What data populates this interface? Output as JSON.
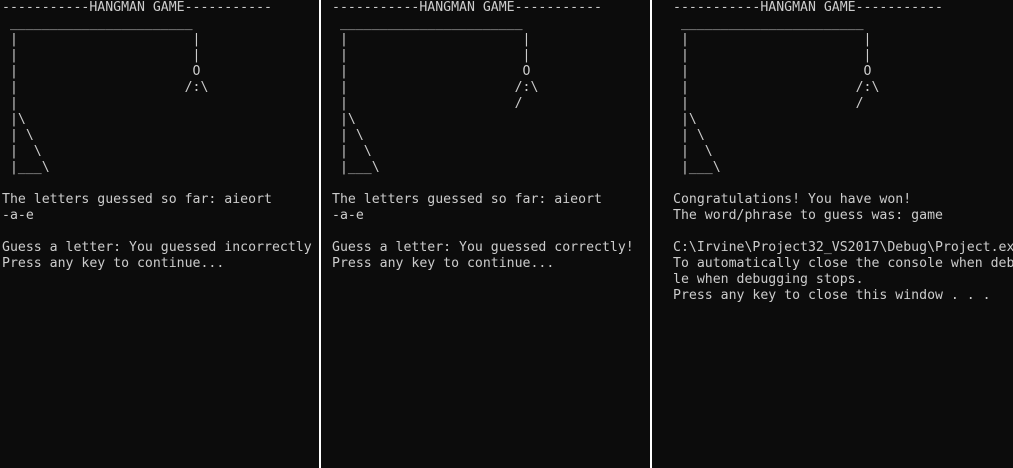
{
  "consoles": [
    {
      "name": "console-incorrect-guess",
      "lines": [
        "-----------HANGMAN GAME-----------",
        " _______________________",
        " |                      |",
        " |                      |",
        " |                      O",
        " |                     /:\\",
        " |",
        " |\\",
        " | \\",
        " |  \\",
        " |___\\",
        "",
        "The letters guessed so far: aieort",
        "-a-e",
        "",
        "Guess a letter: You guessed incorrectly",
        "Press any key to continue..."
      ]
    },
    {
      "name": "console-correct-guess",
      "lines": [
        "-----------HANGMAN GAME-----------",
        " _______________________",
        " |                      |",
        " |                      |",
        " |                      O",
        " |                     /:\\",
        " |                     /",
        " |\\",
        " | \\",
        " |  \\",
        " |___\\",
        "",
        "The letters guessed so far: aieort",
        "-a-e",
        "",
        "Guess a letter: You guessed correctly!",
        "Press any key to continue..."
      ]
    },
    {
      "name": "console-game-won",
      "lines": [
        "-----------HANGMAN GAME-----------",
        " _______________________",
        " |                      |",
        " |                      |",
        " |                      O",
        " |                     /:\\",
        " |                     /",
        " |\\",
        " | \\",
        " |  \\",
        " |___\\",
        "",
        "Congratulations! You have won!",
        "The word/phrase to guess was: game",
        "",
        "C:\\Irvine\\Project32_VS2017\\Debug\\Project.ex",
        "To automatically close the console when deb",
        "le when debugging stops.",
        "Press any key to close this window . . ."
      ]
    }
  ]
}
